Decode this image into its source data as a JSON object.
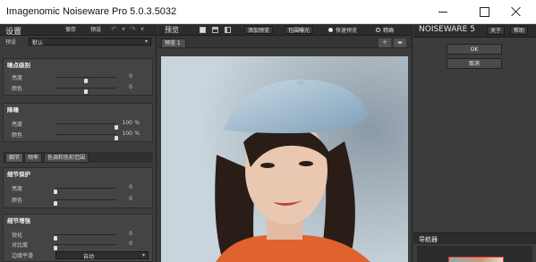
{
  "window": {
    "title": "Imagenomic Noiseware Pro 5.0.3.5032"
  },
  "left": {
    "header": "设置",
    "buttons": {
      "save": "保存",
      "preset": "预设"
    },
    "preset_label": "预设",
    "preset_value": "默认",
    "noise_levels": {
      "title": "噪点级别",
      "rows": [
        {
          "label": "亮度",
          "value": "0",
          "pos": 0.5
        },
        {
          "label": "颜色",
          "value": "0",
          "pos": 0.5
        }
      ]
    },
    "noise_reduction": {
      "title": "降噪",
      "unit": "%",
      "rows": [
        {
          "label": "亮度",
          "value": "100",
          "pos": 1.0
        },
        {
          "label": "颜色",
          "value": "100",
          "pos": 1.0
        }
      ]
    },
    "tabs": [
      "细节",
      "频率",
      "色调和色彩范围"
    ],
    "detail_protection": {
      "title": "细节保护",
      "rows": [
        {
          "label": "亮度",
          "value": "0",
          "pos": 0.0
        },
        {
          "label": "颜色",
          "value": "0",
          "pos": 0.0
        }
      ]
    },
    "detail_enhance": {
      "title": "细节增强",
      "rows": [
        {
          "label": "锐化",
          "value": "0",
          "pos": 0.0
        },
        {
          "label": "对比度",
          "value": "0",
          "pos": 0.0
        }
      ]
    },
    "edge_mode": {
      "label": "边缘平滑",
      "value": "自动"
    }
  },
  "center": {
    "label": "预览",
    "buttons": {
      "add": "添加预览",
      "bg": "包围曝光"
    },
    "radios": [
      {
        "label": "快速预览",
        "checked": true
      },
      {
        "label": "精确",
        "checked": false
      }
    ],
    "preview_tab": "预览 1",
    "plus": "+"
  },
  "right": {
    "brand_main": "NOISEWARE",
    "brand_ver": "5",
    "about": "关于",
    "help": "帮助",
    "ok": "OK",
    "cancel": "取消",
    "navigator": "导航器"
  },
  "icons": [
    "minimize-icon",
    "maximize-icon",
    "close-icon",
    "undo-icon",
    "redo-icon",
    "dropdown-arrow-icon"
  ]
}
